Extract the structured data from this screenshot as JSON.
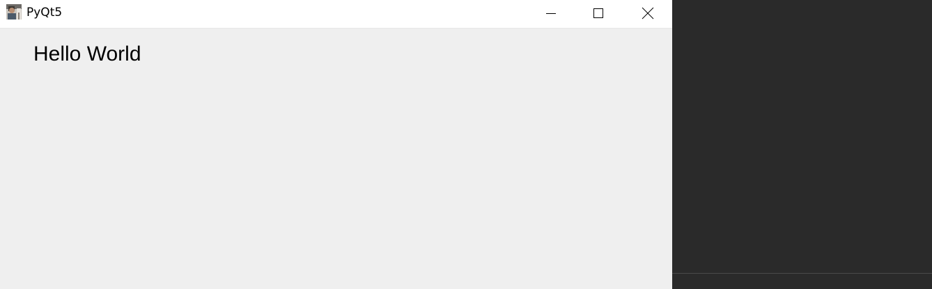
{
  "window": {
    "title": "PyQt5",
    "app_icon": "app-icon-photo",
    "controls": {
      "minimize_icon": "minimize-icon",
      "maximize_icon": "maximize-icon",
      "close_icon": "close-icon"
    }
  },
  "content": {
    "label_text": "Hello World"
  },
  "colors": {
    "titlebar_bg": "#ffffff",
    "window_bg": "#efefef",
    "desktop_bg": "#2a2a2a"
  }
}
